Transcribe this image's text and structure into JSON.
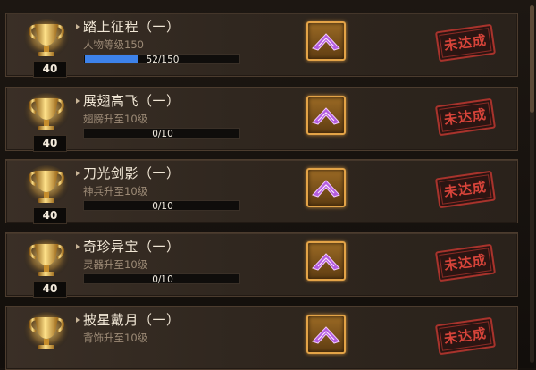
{
  "achievements": [
    {
      "points": "40",
      "title": "踏上征程（一）",
      "requirement": "人物等级150",
      "progress_text": "52/150",
      "progress": 0.347,
      "status": "未达成"
    },
    {
      "points": "40",
      "title": "展翅高飞（一）",
      "requirement": "翅膀升至10级",
      "progress_text": "0/10",
      "progress": 0,
      "status": "未达成"
    },
    {
      "points": "40",
      "title": "刀光剑影（一）",
      "requirement": "神兵升至10级",
      "progress_text": "0/10",
      "progress": 0,
      "status": "未达成"
    },
    {
      "points": "40",
      "title": "奇珍异宝（一）",
      "requirement": "灵器升至10级",
      "progress_text": "0/10",
      "progress": 0,
      "status": "未达成"
    },
    {
      "points": "",
      "title": "披星戴月（一）",
      "requirement": "背饰升至10级",
      "progress_text": "",
      "progress": 0,
      "status": "未达成"
    }
  ],
  "colors": {
    "progress_fill": "#3d82ea",
    "stamp_red": "#d8443a",
    "reward_border": "#e3a347",
    "reward_item": "#b45de0"
  },
  "icons": {
    "trophy": "gold-trophy-icon",
    "reward": "purple-wing-item-icon"
  }
}
